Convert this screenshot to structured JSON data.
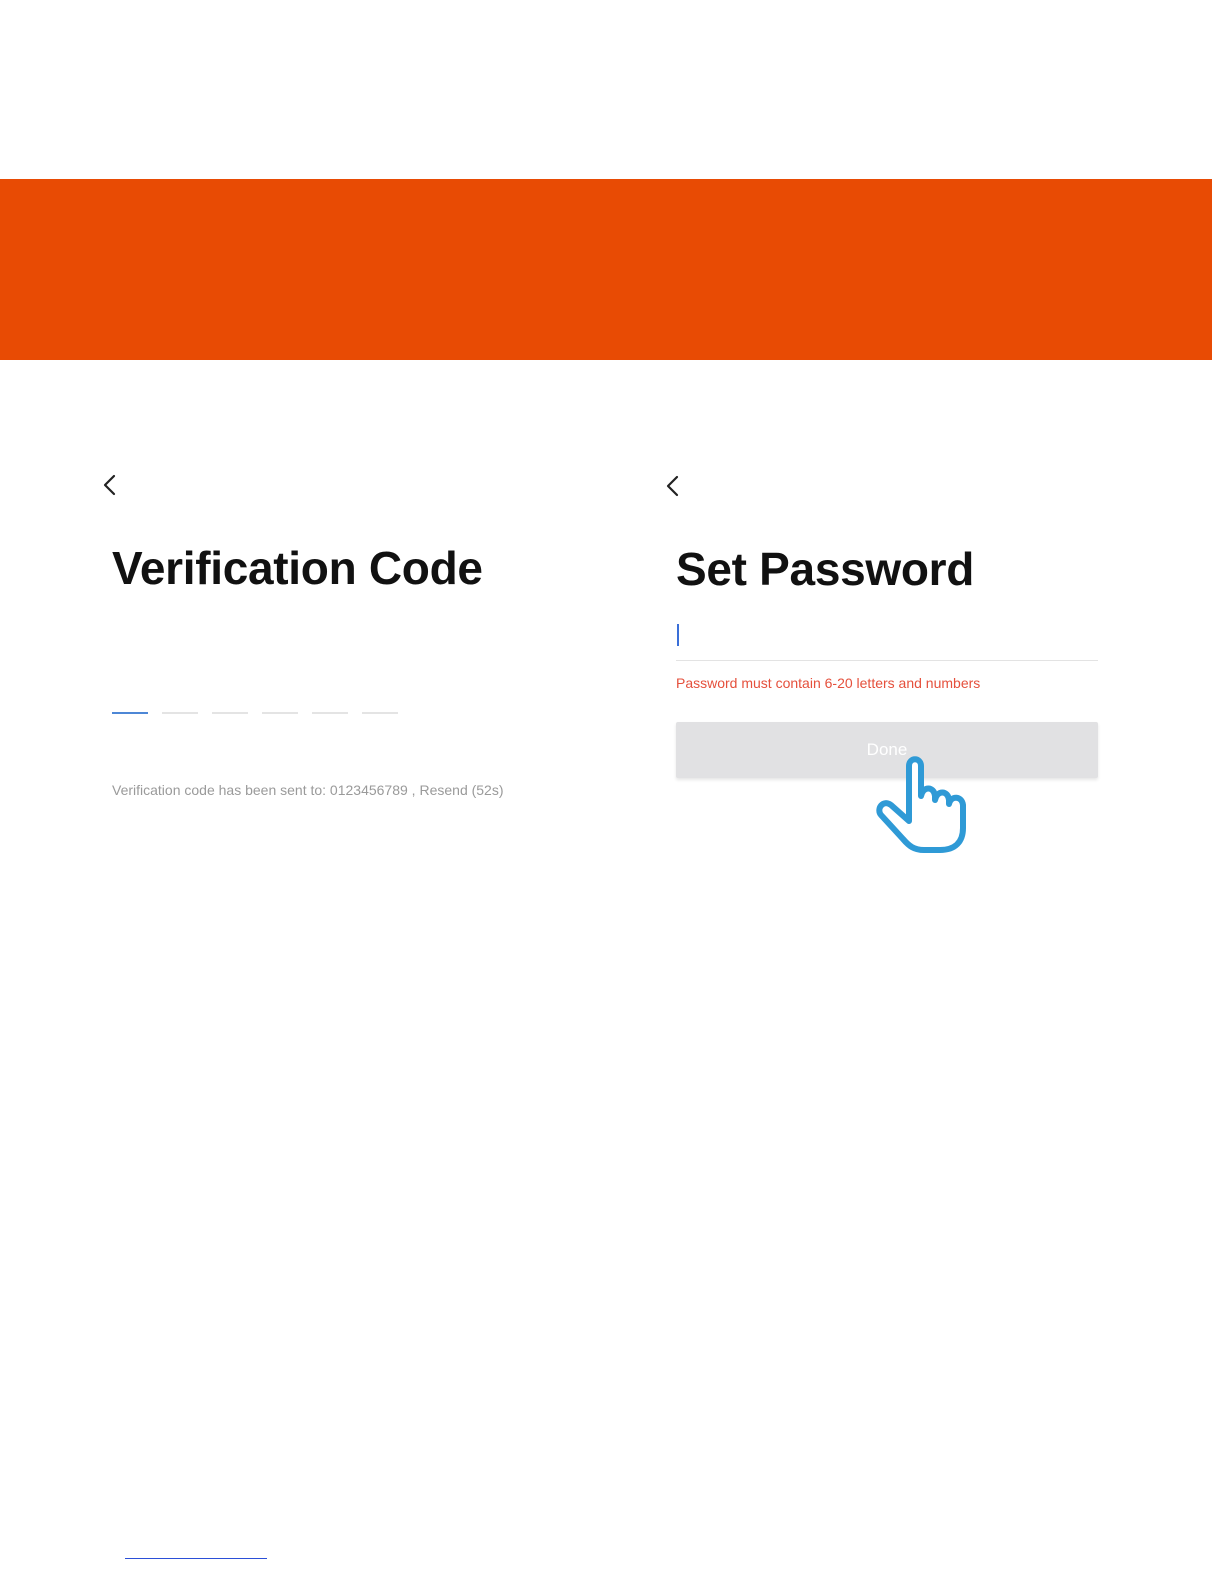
{
  "banner": {
    "color": "#e84b04"
  },
  "verification_screen": {
    "back_icon": "chevron-left-icon",
    "title": "Verification Code",
    "code_slots": [
      {
        "filled": false,
        "active": true
      },
      {
        "filled": false,
        "active": false
      },
      {
        "filled": false,
        "active": false
      },
      {
        "filled": false,
        "active": false
      },
      {
        "filled": false,
        "active": false
      },
      {
        "filled": false,
        "active": false
      }
    ],
    "sent_text": "Verification code has been sent to: 0123456789 ,",
    "resend_text": "Resend (52s)"
  },
  "password_screen": {
    "back_icon": "chevron-left-icon",
    "title": "Set Password",
    "password_value": "",
    "hint": "Password must contain 6-20 letters and numbers",
    "hint_color": "#e5503c",
    "done_label": "Done",
    "pointer_icon": "hand-pointer-icon"
  }
}
